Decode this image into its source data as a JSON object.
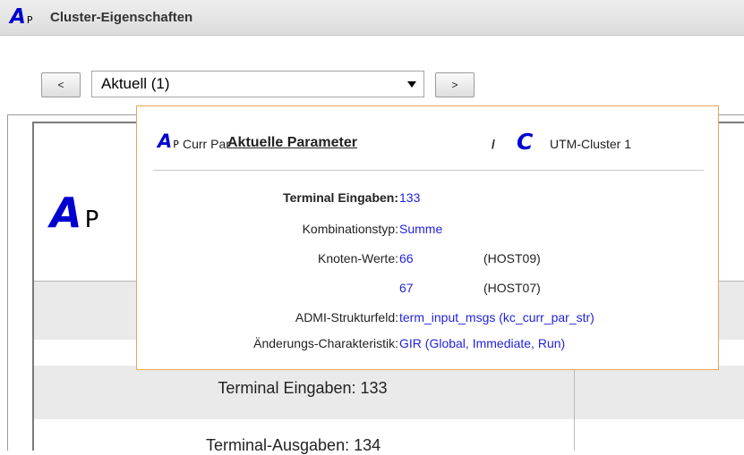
{
  "window": {
    "logo_letter": "A",
    "logo_sub": "P",
    "title": "Cluster-Eigenschaften"
  },
  "toolbar": {
    "prev_label": "<",
    "next_label": ">",
    "selected": "Aktuell (1)"
  },
  "background": {
    "logo_letter": "A",
    "logo_sub": "P",
    "row_label": "Terminal Eingaben:",
    "row_value": "133",
    "partial_text": "Terminal-Ausgaben:   134"
  },
  "popup": {
    "logo_letter": "A",
    "logo_sub": "P",
    "short_name": "Curr Par",
    "link": "Aktuelle Parameter",
    "separator": "/",
    "cluster_icon": "C",
    "cluster_name": "UTM-Cluster 1",
    "rows": [
      {
        "label": "Terminal Eingaben:",
        "value": "133"
      },
      {
        "label": "Kombinationstyp:",
        "value": "Summe"
      },
      {
        "label": "Knoten-Werte:",
        "value": "66",
        "host": "(HOST09)"
      },
      {
        "label": "",
        "value": "67",
        "host": "(HOST07)"
      },
      {
        "label": "ADMI-Strukturfeld:",
        "value": "term_input_msgs (kc_curr_par_str)"
      },
      {
        "label": "Änderungs-Charakteristik:",
        "value": "GIR (Global, Immediate, Run)"
      }
    ]
  },
  "colors": {
    "accent_blue": "#0000d0",
    "value_blue": "#2222dd",
    "popup_border": "#e7a656"
  }
}
